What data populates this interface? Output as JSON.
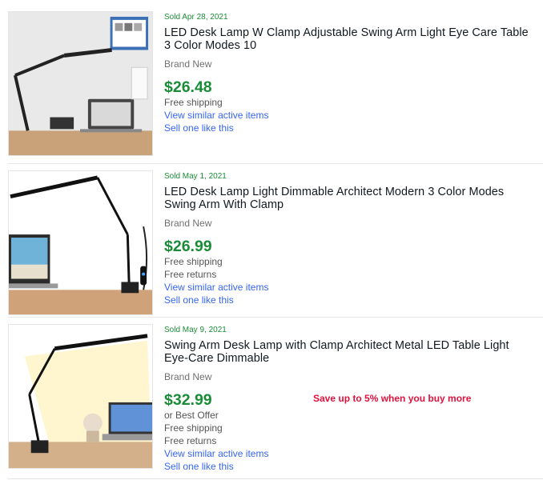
{
  "items": [
    {
      "sold": "Sold Apr 28, 2021",
      "title": "LED Desk Lamp W Clamp Adjustable Swing Arm Light Eye Care Table 3 Color Modes 10",
      "condition": "Brand New",
      "price": "$26.48",
      "lines": [
        "Free shipping"
      ],
      "similar_link": "View similar active items",
      "sell_link": "Sell one like this"
    },
    {
      "sold": "Sold May 1, 2021",
      "title": "LED Desk Lamp Light Dimmable Architect Modern 3 Color Modes Swing Arm With Clamp",
      "condition": "Brand New",
      "price": "$26.99",
      "lines": [
        "Free shipping",
        "Free returns"
      ],
      "similar_link": "View similar active items",
      "sell_link": "Sell one like this"
    },
    {
      "sold": "Sold May 9, 2021",
      "title": "Swing Arm Desk Lamp with Clamp Architect Metal LED Table Light Eye-Care Dimmable",
      "condition": "Brand New",
      "price": "$32.99",
      "lines": [
        "or Best Offer",
        "Free shipping",
        "Free returns"
      ],
      "similar_link": "View similar active items",
      "sell_link": "Sell one like this",
      "promo": "Save up to 5% when you buy more"
    }
  ],
  "colors": {
    "sold_green": "#1a8c37",
    "link_blue": "#3665f3",
    "promo_red": "#e0113d"
  }
}
